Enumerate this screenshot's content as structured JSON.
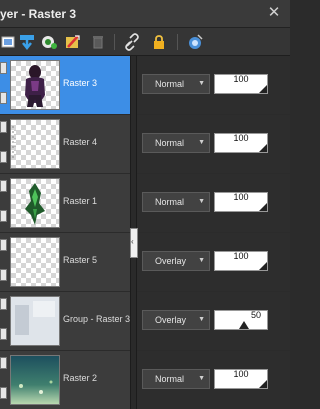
{
  "window": {
    "title": "yer - Raster 3",
    "close_glyph": "✕"
  },
  "toolbar": {
    "icons": [
      "new-layer-icon",
      "merge-down-icon",
      "mask-icon",
      "adjustment-layer-icon",
      "trash-icon",
      "link-icon",
      "lock-icon",
      "blend-ranges-icon"
    ]
  },
  "layers": [
    {
      "name": "Raster 3",
      "blend_mode": "Normal",
      "opacity": "100",
      "selected": true
    },
    {
      "name": "Raster 4",
      "blend_mode": "Normal",
      "opacity": "100",
      "selected": false
    },
    {
      "name": "Raster 1",
      "blend_mode": "Normal",
      "opacity": "100",
      "selected": false
    },
    {
      "name": "Raster 5",
      "blend_mode": "Overlay",
      "opacity": "100",
      "selected": false
    },
    {
      "name": "Group - Raster 3",
      "blend_mode": "Overlay",
      "opacity": "50",
      "selected": false
    },
    {
      "name": "Raster 2",
      "blend_mode": "Normal",
      "opacity": "100",
      "selected": false
    }
  ],
  "colors": {
    "selection": "#3d8ee6",
    "panel": "#2b2b2b"
  }
}
